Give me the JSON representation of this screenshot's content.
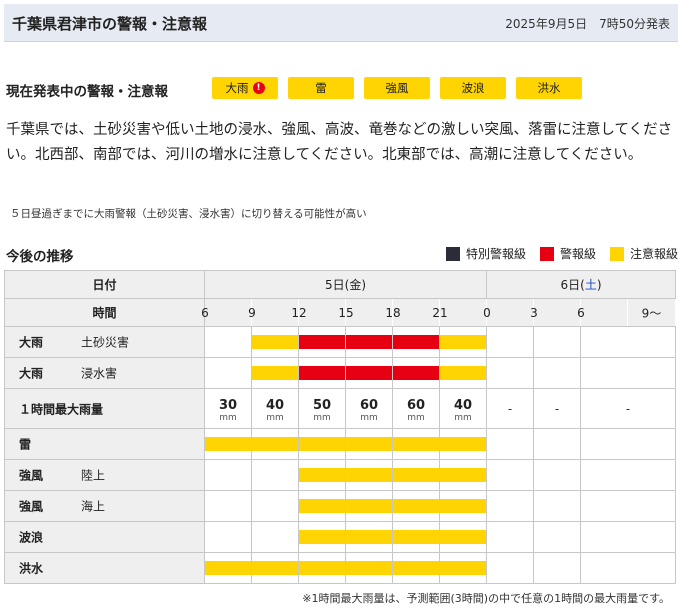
{
  "header": {
    "title": "千葉県君津市の警報・注意報",
    "issued": "2025年9月5日　7時50分発表"
  },
  "current": {
    "label": "現在発表中の警報・注意報",
    "badges": [
      {
        "label": "大雨",
        "warning_icon": true
      },
      {
        "label": "雷",
        "warning_icon": false
      },
      {
        "label": "強風",
        "warning_icon": false
      },
      {
        "label": "波浪",
        "warning_icon": false
      },
      {
        "label": "洪水",
        "warning_icon": false
      }
    ]
  },
  "description": "千葉県では、土砂災害や低い土地の浸水、強風、高波、竜巻などの激しい突風、落雷に注意してください。北西部、南部では、河川の増水に注意してください。北東部では、高潮に注意してください。",
  "upgrade_note": "５日昼過ぎまでに大雨警報（土砂災害、浸水害）に切り替える可能性が高い",
  "trend": {
    "label": "今後の推移",
    "legend": [
      {
        "label": "特別警報級",
        "color": "#2b2b3a"
      },
      {
        "label": "警報級",
        "color": "#e60012"
      },
      {
        "label": "注意報級",
        "color": "#ffd400"
      }
    ],
    "date_header": "日付",
    "time_header": "時間",
    "day1": "5日(金)",
    "day2_prefix": "6日(",
    "day2_weekday": "土",
    "day2_suffix": ")",
    "times": [
      "6",
      "9",
      "12",
      "15",
      "18",
      "21",
      "0",
      "3",
      "6",
      "9～"
    ],
    "rows": [
      {
        "main": "大雨",
        "sub": "土砂災害",
        "levels": [
          "none",
          "adv",
          "warn",
          "warn",
          "warn",
          "adv",
          "none",
          "none",
          "none"
        ]
      },
      {
        "main": "大雨",
        "sub": "浸水害",
        "levels": [
          "none",
          "adv",
          "warn",
          "warn",
          "warn",
          "adv",
          "none",
          "none",
          "none"
        ]
      },
      {
        "main": "１時間最大雨量",
        "sub": "",
        "rain": [
          "30",
          "40",
          "50",
          "60",
          "60",
          "40",
          "-",
          "-",
          "-"
        ],
        "unit": "mm"
      },
      {
        "main": "雷",
        "sub": "",
        "levels": [
          "adv",
          "adv",
          "adv",
          "adv",
          "adv",
          "adv",
          "none",
          "none",
          "none"
        ]
      },
      {
        "main": "強風",
        "sub": "陸上",
        "levels": [
          "none",
          "none",
          "adv",
          "adv",
          "adv",
          "adv",
          "none",
          "none",
          "none"
        ]
      },
      {
        "main": "強風",
        "sub": "海上",
        "levels": [
          "none",
          "none",
          "adv",
          "adv",
          "adv",
          "adv",
          "none",
          "none",
          "none"
        ]
      },
      {
        "main": "波浪",
        "sub": "",
        "levels": [
          "none",
          "none",
          "adv",
          "adv",
          "adv",
          "adv",
          "none",
          "none",
          "none"
        ]
      },
      {
        "main": "洪水",
        "sub": "",
        "levels": [
          "adv",
          "adv",
          "adv",
          "adv",
          "adv",
          "adv",
          "none",
          "none",
          "none"
        ]
      }
    ]
  },
  "footnote": "※1時間最大雨量は、予測範囲(3時間)の中で任意の1時間の最大雨量です。"
}
